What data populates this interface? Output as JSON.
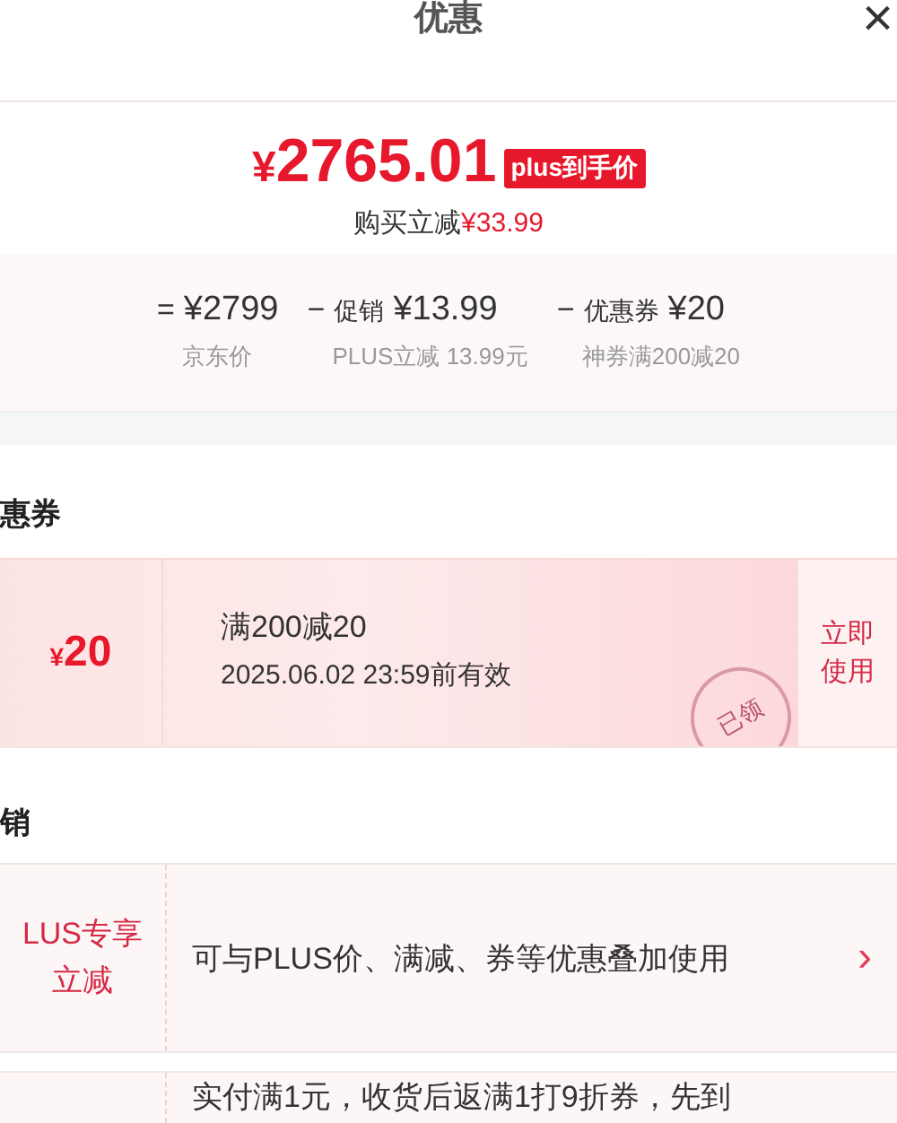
{
  "header": {
    "title": "优惠",
    "close": "×"
  },
  "price": {
    "amount": "2765.01",
    "currency": "¥",
    "badge": "plus到手价",
    "saving_label": "购买立减",
    "saving": "¥33.99"
  },
  "breakdown": [
    {
      "op": "=",
      "value": "¥2799",
      "note": "京东价"
    },
    {
      "op": "−",
      "label": "促销",
      "value": "¥13.99",
      "note": "PLUS立减 13.99元"
    },
    {
      "op": "−",
      "label": "优惠券",
      "value": "¥20",
      "note": "神券满200减20"
    }
  ],
  "coupon_section": {
    "title": "惠券",
    "coupons": [
      {
        "currency": "¥",
        "amount": "20",
        "rule": "满200减20",
        "validity": "2025.06.02 23:59前有效",
        "stamp": "已领",
        "action": "立即使用",
        "claimed": true
      }
    ]
  },
  "promo_section": {
    "title": "销",
    "promos": [
      {
        "tag": "LUS专享立减",
        "text": "可与PLUS价、满减、券等优惠叠加使用",
        "chevron": "›"
      },
      {
        "text": "实付满1元，收货后返满1打9折券，先到"
      }
    ]
  }
}
